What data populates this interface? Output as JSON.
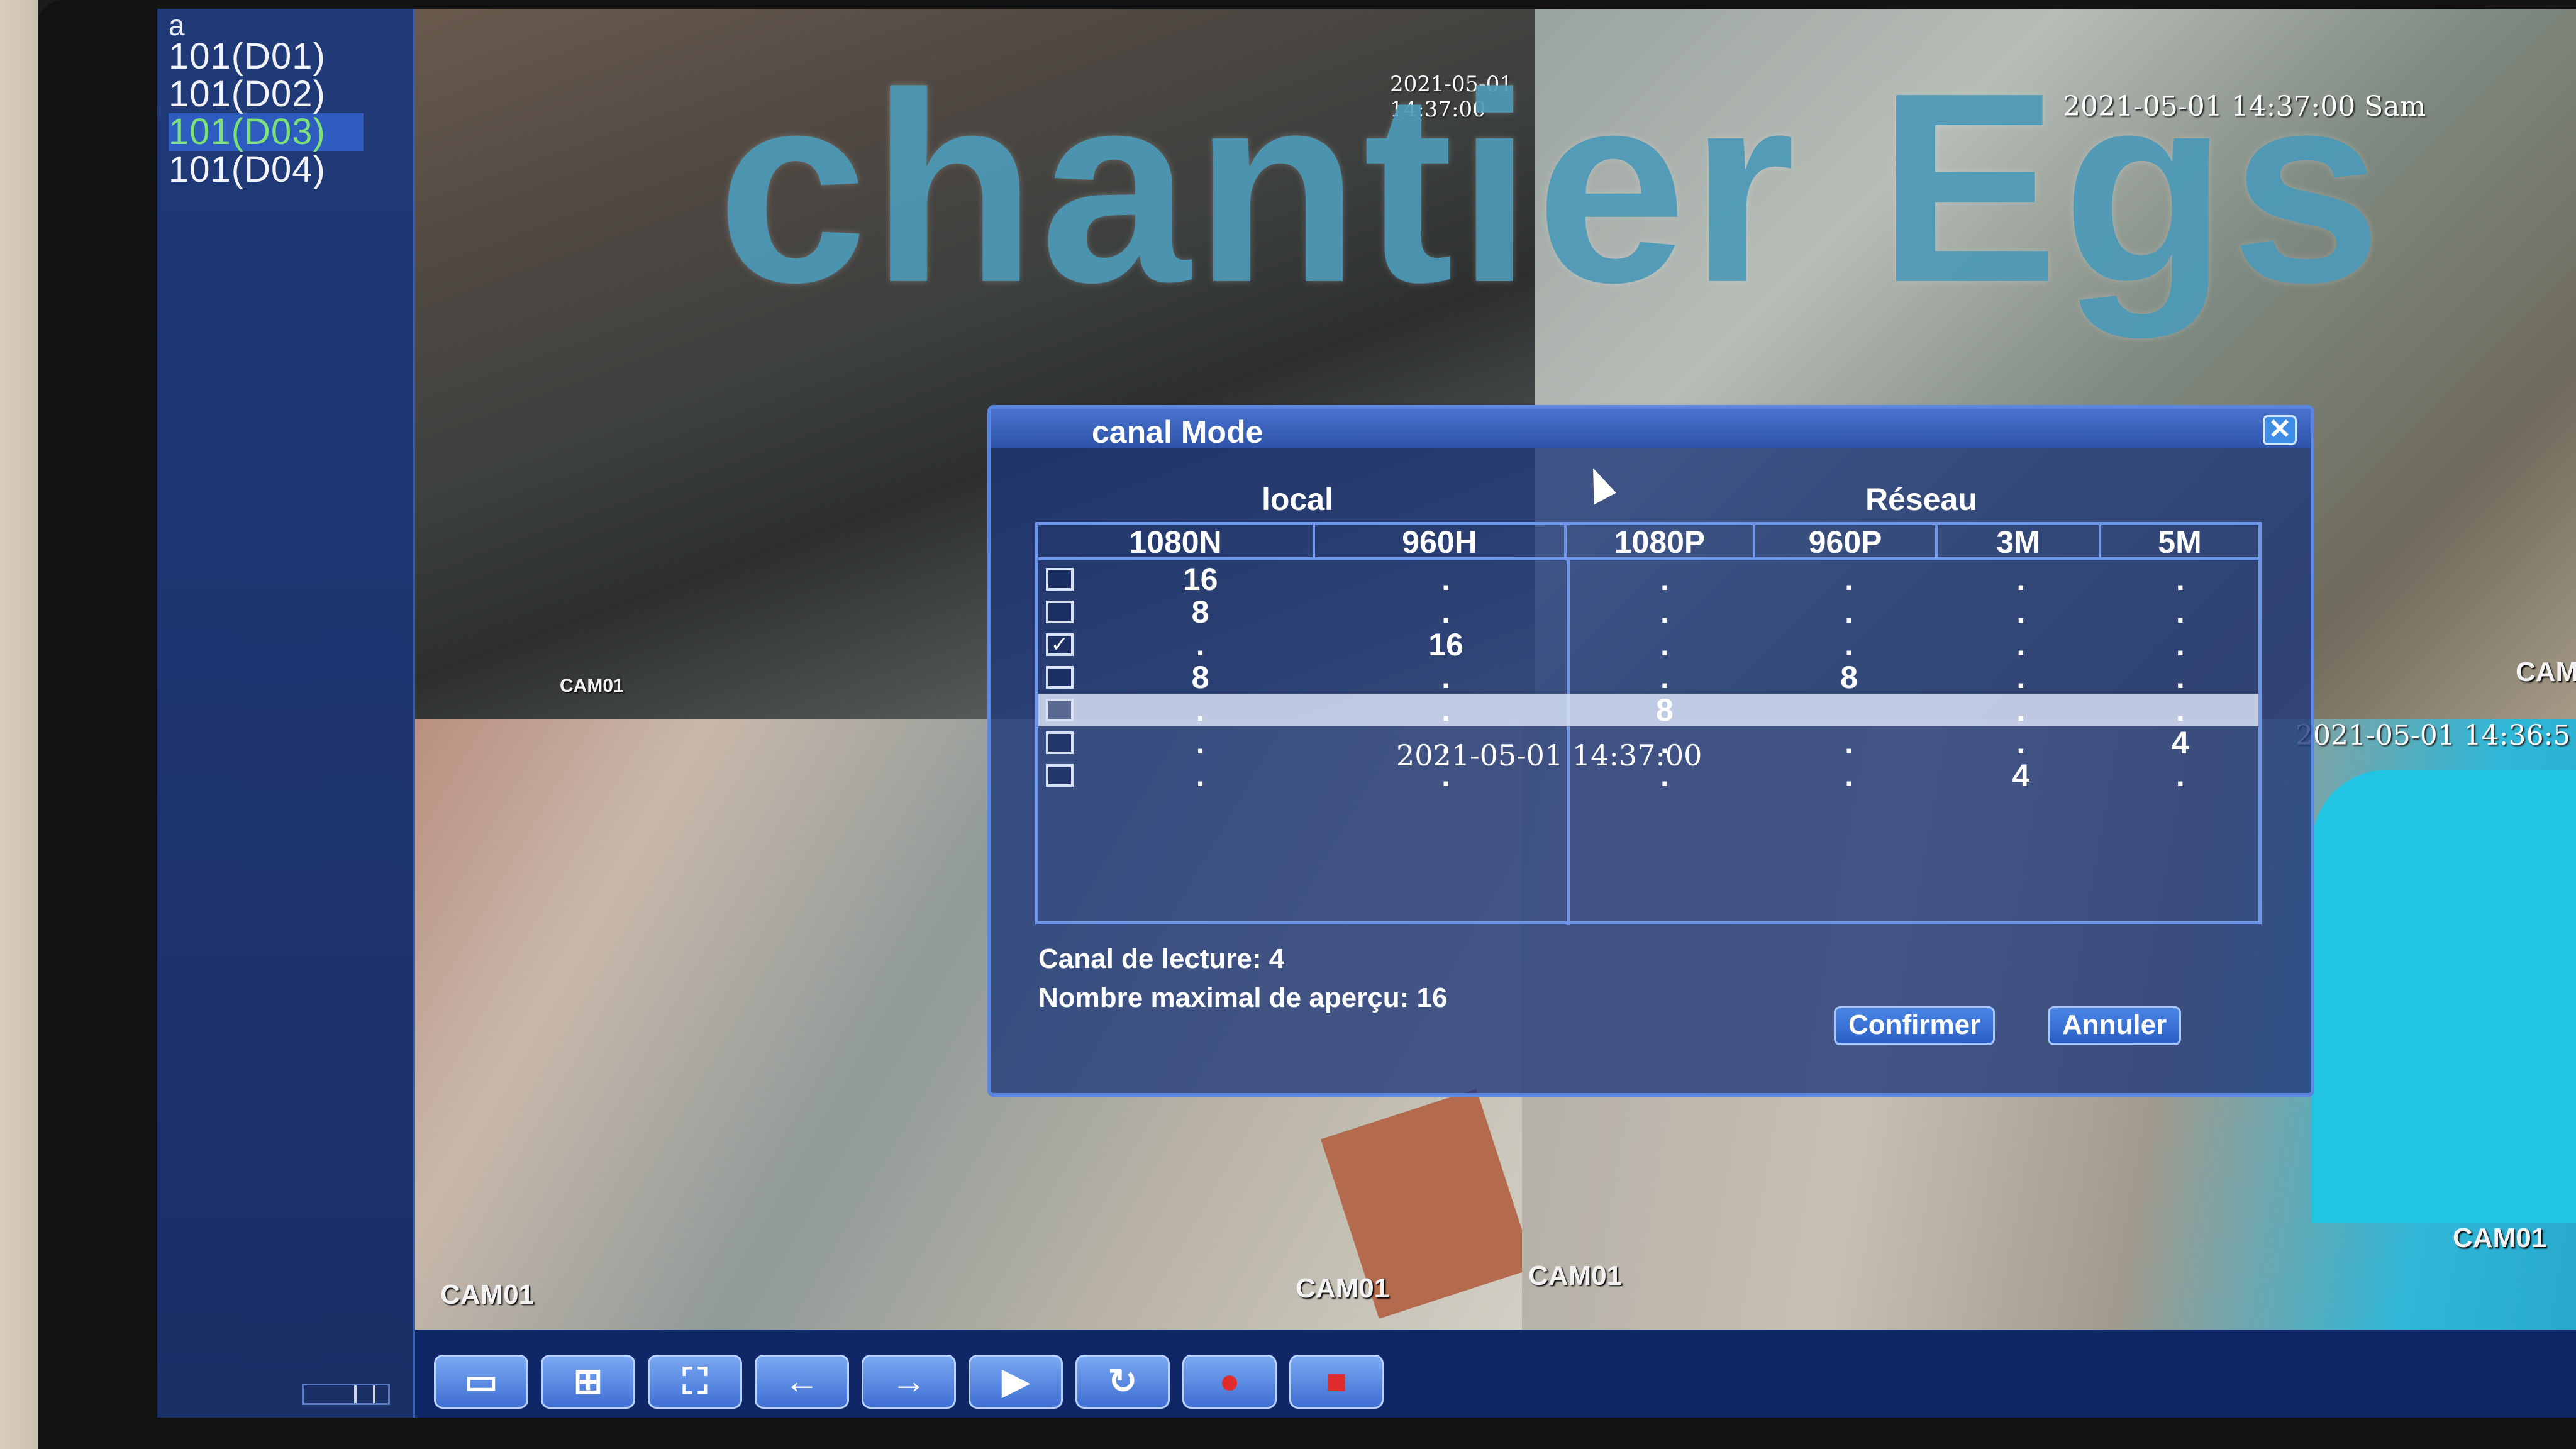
{
  "sidebar": {
    "header": "a",
    "channels": [
      {
        "label": "101(D01)",
        "selected": false
      },
      {
        "label": "101(D02)",
        "selected": false
      },
      {
        "label": "101(D03)",
        "selected": true
      },
      {
        "label": "101(D04)",
        "selected": false
      }
    ]
  },
  "cameras": [
    {
      "label": "CAM01",
      "timestamp": "2021-05-01 14:37:00"
    },
    {
      "label": "CAM",
      "timestamp": "2021-05-01 14:37:00 Sam"
    },
    {
      "label": "CAM01",
      "timestamp": ""
    },
    {
      "label": "CAM01",
      "timestamp": "2021-05-01 14:36:5"
    }
  ],
  "cam3_extra_label": "CAM01",
  "cam4_top_label": "CAM01",
  "watermark": "chantier Egs",
  "dialog": {
    "title": "canal Mode",
    "close_label": "✕",
    "group_local": "local",
    "group_network": "Réseau",
    "columns": [
      "1080N",
      "960H",
      "1080P",
      "960P",
      "3M",
      "5M"
    ],
    "rows": [
      {
        "checked": false,
        "highlight": false,
        "values": [
          "16",
          ".",
          ".",
          ".",
          ".",
          "."
        ]
      },
      {
        "checked": false,
        "highlight": false,
        "values": [
          "8",
          ".",
          ".",
          ".",
          ".",
          "."
        ]
      },
      {
        "checked": true,
        "highlight": false,
        "values": [
          ".",
          "16",
          ".",
          ".",
          ".",
          "."
        ]
      },
      {
        "checked": false,
        "highlight": false,
        "values": [
          "8",
          ".",
          ".",
          "8",
          ".",
          "."
        ]
      },
      {
        "checked": false,
        "highlight": true,
        "values": [
          ".",
          ".",
          "8",
          "",
          ".",
          "."
        ]
      },
      {
        "checked": false,
        "highlight": false,
        "values": [
          ".",
          ".",
          ".",
          ".",
          ".",
          "4"
        ]
      },
      {
        "checked": false,
        "highlight": false,
        "values": [
          ".",
          ".",
          ".",
          ".",
          "4",
          "."
        ]
      }
    ],
    "playback_channels": "Canal de lecture: 4",
    "max_preview": "Nombre maximal de aperçu: 16",
    "confirm_label": "Confirmer",
    "cancel_label": "Annuler",
    "overlay_timestamp": "2021-05-01 14:37:00"
  },
  "toolbar": {
    "buttons": [
      {
        "name": "single-view-button",
        "glyph": "▭"
      },
      {
        "name": "quad-view-button",
        "glyph": "⊞"
      },
      {
        "name": "fullscreen-button",
        "glyph": "⛶"
      },
      {
        "name": "previous-button",
        "glyph": "←"
      },
      {
        "name": "next-button",
        "glyph": "→"
      },
      {
        "name": "playback-button",
        "glyph": "▶"
      },
      {
        "name": "tour-button",
        "glyph": "↻"
      },
      {
        "name": "record-button",
        "glyph": "●"
      },
      {
        "name": "stop-record-button",
        "glyph": "■"
      }
    ]
  }
}
